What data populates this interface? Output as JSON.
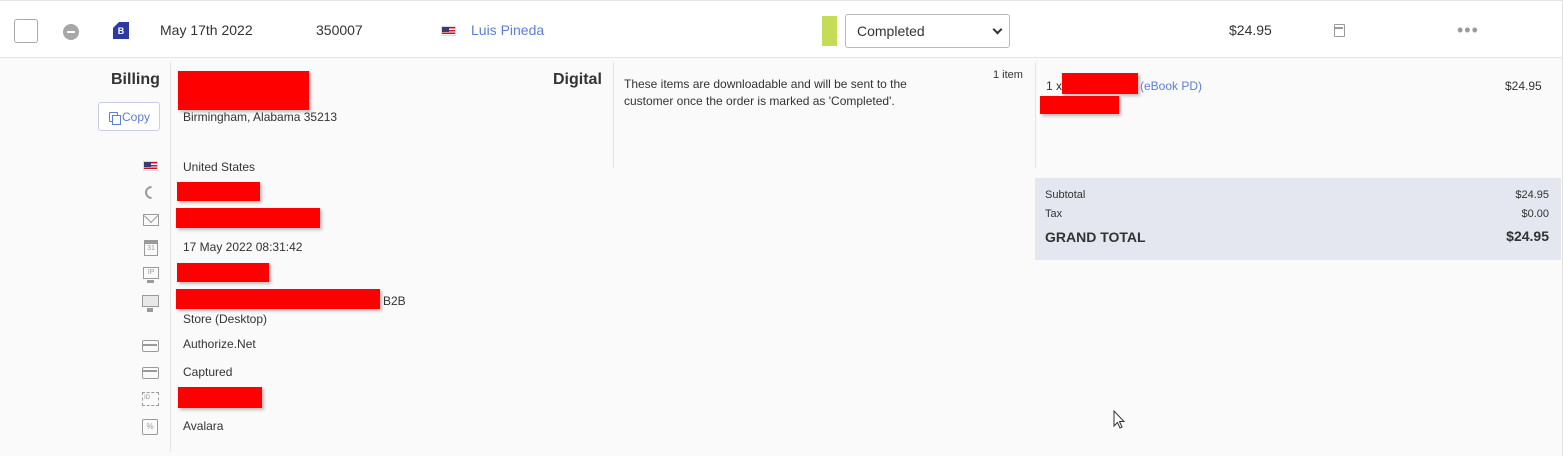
{
  "order": {
    "date": "May 17th 2022",
    "number": "350007",
    "customer_name": "Luis Pineda",
    "status_color": "#c5dd56",
    "status": "Completed",
    "total": "$24.95",
    "badge_letter": "B"
  },
  "billing": {
    "title": "Billing",
    "copy_label": "Copy",
    "address_line": "Birmingham, Alabama 35213",
    "country": "United States",
    "created": "17 May 2022 08:31:42",
    "channel_suffix": "B2B",
    "store": "Store (Desktop)",
    "payment_gateway": "Authorize.Net",
    "payment_status": "Captured",
    "tax_provider": "Avalara"
  },
  "digital": {
    "title": "Digital",
    "description": "These items are downloadable and will be sent to the customer once the order is marked as 'Completed'.",
    "item_count": "1 item",
    "items": [
      {
        "qty": "1 x",
        "product": "(eBook PD)",
        "price": "$24.95"
      }
    ]
  },
  "totals": {
    "subtotal_label": "Subtotal",
    "subtotal": "$24.95",
    "tax_label": "Tax",
    "tax": "$0.00",
    "grand_total_label": "GRAND TOTAL",
    "grand_total": "$24.95"
  },
  "icons": {
    "calendar": "calendar-icon",
    "more": "more-icon",
    "phone": "phone-icon",
    "email": "email-icon",
    "ip": "ip-icon",
    "desktop": "desktop-icon",
    "card": "credit-card-icon",
    "id": "id-icon",
    "tax": "tax-icon"
  }
}
